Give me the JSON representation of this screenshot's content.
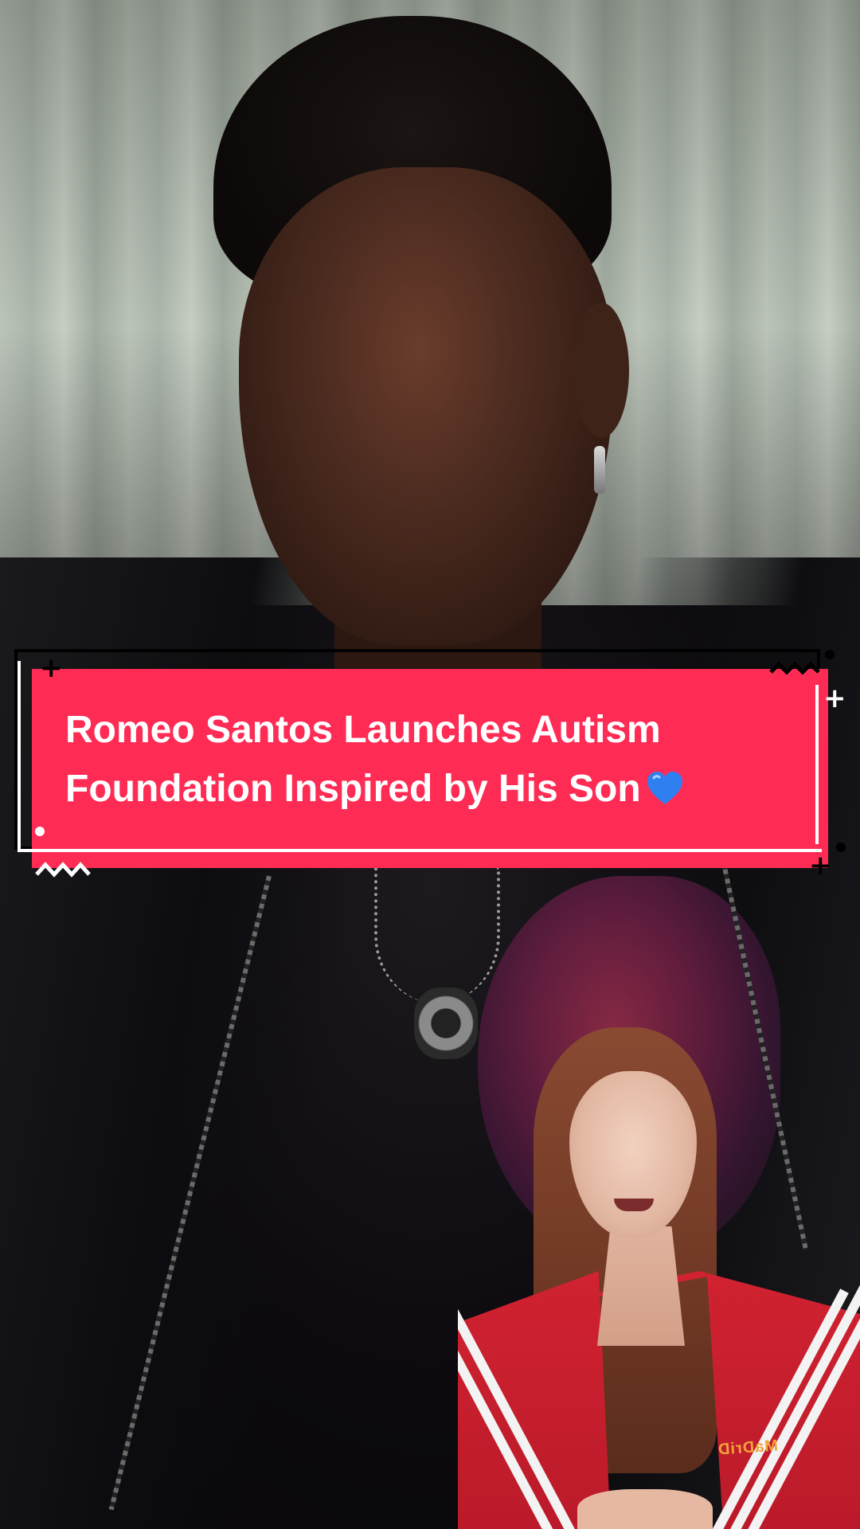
{
  "title_card": {
    "line1": "Romeo Santos Launches Autism",
    "line2": "Foundation Inspired by His Son",
    "heart_icon": "blue-heart-emoji",
    "background_color": "#fe2c55",
    "text_color": "#ffffff"
  },
  "creator_pip": {
    "jacket_print": "MaDriD",
    "jacket_color": "#d32332"
  },
  "decorations": {
    "accent_light": "#ffffff",
    "accent_dark": "#000000"
  }
}
